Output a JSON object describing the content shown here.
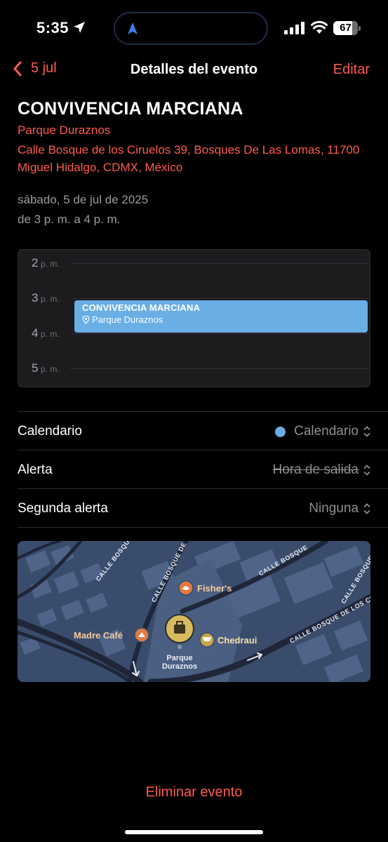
{
  "status_bar": {
    "time": "5:35",
    "battery": "67"
  },
  "nav": {
    "back_label": "5 jul",
    "title": "Detalles del evento",
    "edit_label": "Editar"
  },
  "event": {
    "title": "CONVIVENCIA MARCIANA",
    "location_name": "Parque Duraznos",
    "address": "Calle Bosque de los Ciruelos 39, Bosques De Las Lomas, 11700 Miguel Hidalgo, CDMX, México",
    "date": "sábado, 5 de jul de 2025",
    "time_range": "de 3 p. m. a 4 p. m."
  },
  "day_preview": {
    "hours": [
      {
        "h": "2",
        "ap": "p. m."
      },
      {
        "h": "3",
        "ap": "p. m."
      },
      {
        "h": "4",
        "ap": "p. m."
      },
      {
        "h": "5",
        "ap": "p. m."
      }
    ],
    "event_title": "CONVIVENCIA MARCIANA",
    "event_location": "Parque Duraznos",
    "event_color": "#6aaee6"
  },
  "rows": [
    {
      "label": "Calendario",
      "value": "Calendario",
      "has_dot": true
    },
    {
      "label": "Alerta",
      "value": "Hora de salida",
      "strikethrough": true
    },
    {
      "label": "Segunda alerta",
      "value": "Ninguna"
    }
  ],
  "map": {
    "streets": [
      "CALLE BOSQUE DE",
      "CALLE BOSQUE DE",
      "CALLE BOSQUE",
      "CALLE BOSQUE DE LOS CIR",
      "CALLE BOSQUE DE LOS CIR"
    ],
    "pois": [
      "Fisher's",
      "Madre Café",
      "Chedraui"
    ],
    "pin_label_1": "Parque",
    "pin_label_2": "Duraznos"
  },
  "delete_label": "Eliminar evento",
  "colors": {
    "accent": "#ff5a4d",
    "calendar": "#6aaee6",
    "background": "#000000"
  }
}
